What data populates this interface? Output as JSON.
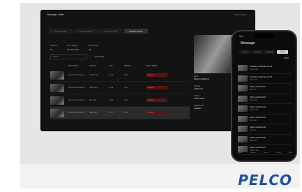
{
  "brand": "PELCO",
  "laptop": {
    "app_title": "Manager Letter",
    "user": "Administrator",
    "tabs": [
      "Review Clips",
      "Analytic View",
      "Top Cameras",
      "Events Center"
    ],
    "filters": [
      {
        "label": "Camera",
        "value": "All"
      },
      {
        "label": "Time Range",
        "value": "Last 24 hours"
      },
      {
        "label": "Event Type",
        "value": "All"
      }
    ],
    "search_placeholder": "Search",
    "matches": "12 results",
    "columns": [
      "",
      "Event Name",
      "Camera",
      "Time",
      "Duration",
      "Action Status"
    ],
    "rows": [
      {
        "name": "Intrusion Area Zone 1",
        "camera": "Lobby Cam",
        "time": "10:12",
        "duration": "0:32",
        "status": "Review"
      },
      {
        "name": "Intrusion Area Zone 2",
        "camera": "Dock Cam",
        "time": "10:48",
        "duration": "0:21",
        "status": "Review"
      },
      {
        "name": "Intrusion Area Zone 3",
        "camera": "Exit Cam",
        "time": "11:05",
        "duration": "0:44",
        "status": "Review"
      },
      {
        "name": "Intrusion Area Zone 4",
        "camera": "Gate Cam",
        "time": "11:27",
        "duration": "0:18",
        "status": "Review"
      }
    ],
    "panel": [
      {
        "label": "Event",
        "value": "Object Left Behind"
      },
      {
        "label": "Camera",
        "value": "Lobby Cam"
      },
      {
        "label": "Status",
        "value": "Under review"
      },
      {
        "label": "Assigned To",
        "value": "Operator"
      }
    ]
  },
  "phone": {
    "time": "9:41",
    "title": "Message",
    "tabs": [
      "Alerts",
      "Events",
      "Cameras",
      "Review"
    ],
    "active_tab": 3,
    "filter": "Filter",
    "items": [
      {
        "title": "Escalating Unattended at 1:30",
        "sub": "Lobby Cam"
      },
      {
        "title": "Escalating Unattended at 2:30",
        "sub": "Dock Cam"
      },
      {
        "title": "Object Left Behind 01",
        "sub": "Exit Cam"
      },
      {
        "title": "Object Left Behind 02",
        "sub": "Gate Cam"
      },
      {
        "title": "Object Left Behind 03",
        "sub": "Lobby Cam"
      },
      {
        "title": "Object Left Behind 04",
        "sub": "Dock Cam"
      },
      {
        "title": "Object Left Behind 05",
        "sub": "Exit Cam"
      },
      {
        "title": "Object Left Behind 06",
        "sub": "Gate Cam"
      },
      {
        "title": "Object Left Behind 07",
        "sub": "Lobby Cam"
      }
    ],
    "nav": [
      "Home",
      "Cameras",
      "Events",
      "Review",
      "More"
    ]
  }
}
